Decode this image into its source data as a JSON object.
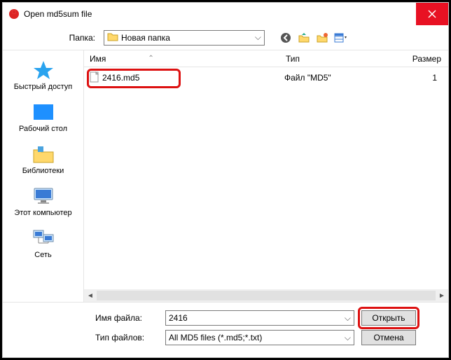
{
  "titlebar": {
    "title": "Open md5sum file"
  },
  "toolbar": {
    "folder_label": "Папка:",
    "folder_value": "Новая папка"
  },
  "sidebar": {
    "items": [
      {
        "label": "Быстрый доступ"
      },
      {
        "label": "Рабочий стол"
      },
      {
        "label": "Библиотеки"
      },
      {
        "label": "Этот компьютер"
      },
      {
        "label": "Сеть"
      }
    ]
  },
  "columns": {
    "name": "Имя",
    "type": "Тип",
    "size": "Размер"
  },
  "files": [
    {
      "name": "2416.md5",
      "type": "Файл \"MD5\"",
      "size": "1"
    }
  ],
  "bottom": {
    "filename_label": "Имя файла:",
    "filename_value": "2416",
    "filetype_label": "Тип файлов:",
    "filetype_value": "All MD5 files (*.md5;*.txt)",
    "open": "Открыть",
    "cancel": "Отмена"
  }
}
